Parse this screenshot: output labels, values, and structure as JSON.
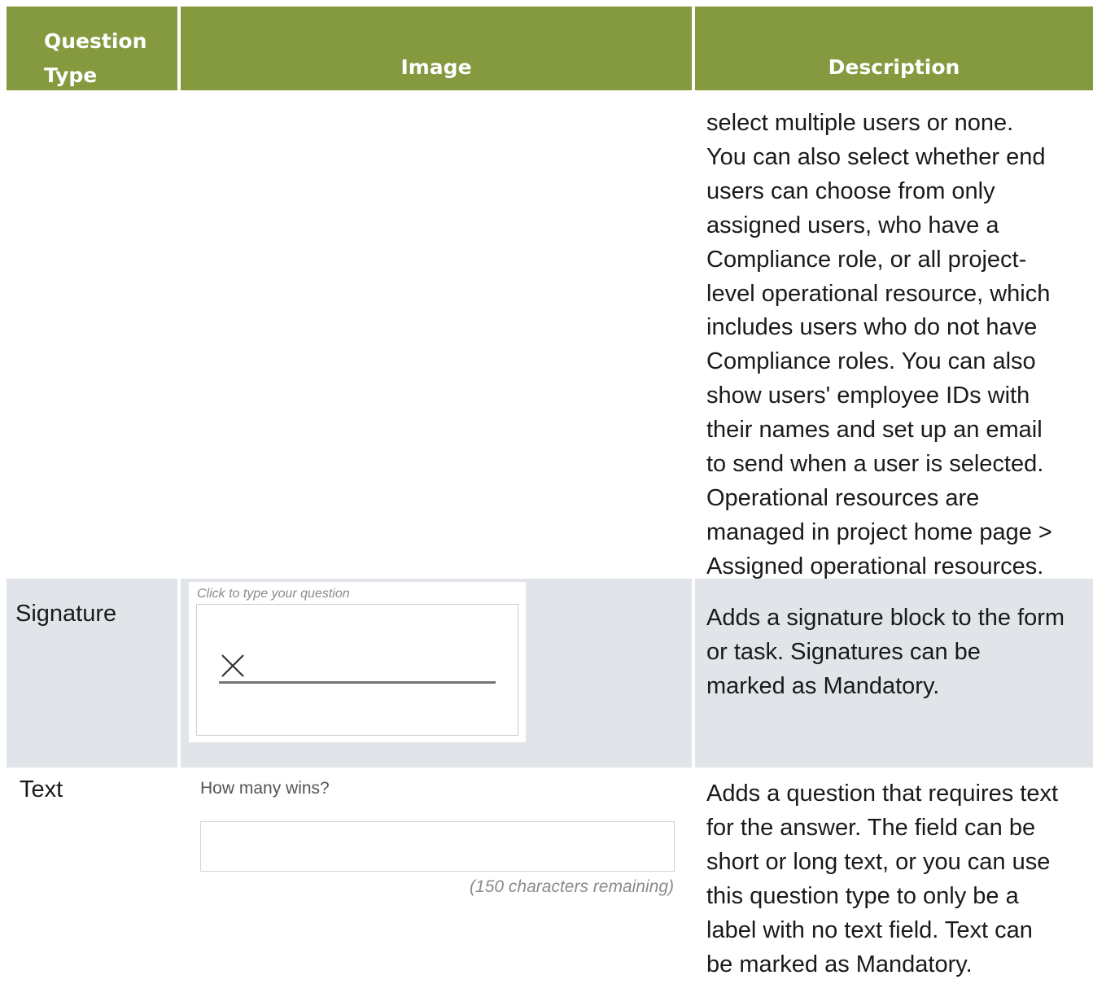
{
  "header": {
    "col1_line1": "Question",
    "col1_line2": "Type",
    "col2": "Image",
    "col3": "Description"
  },
  "continued_row": {
    "description_lines": [
      "select multiple users or none.",
      "You can also select whether end",
      "users can choose from only",
      "assigned users, who have a",
      "Compliance role, or all project-",
      "level operational resource, which",
      "includes users who do not have",
      "Compliance roles. You can also",
      "show users' employee IDs with",
      "their names and set up an email",
      "to send when a user is selected.",
      "Operational resources are",
      "managed in project home page >",
      "Assigned operational resources."
    ]
  },
  "signature_row": {
    "type": "Signature",
    "image": {
      "question_placeholder": "Click to type your question",
      "x_mark": "×"
    },
    "description_lines": [
      "Adds a signature block to the form",
      "or task. Signatures can be",
      "marked as Mandatory."
    ]
  },
  "text_row": {
    "type": "Text",
    "image": {
      "question": "How many wins?",
      "input_value": "",
      "remaining": "(150 characters remaining)"
    },
    "description_lines": [
      "Adds a question that requires text",
      "for the answer. The field can be",
      "short or long text, or you can use",
      "this question type to only be a",
      "label with no text field. Text can",
      "be marked as Mandatory."
    ]
  },
  "colors": {
    "header_bg": "#85993e",
    "header_text": "#ffffff",
    "shaded_row": "#e1e4e8"
  }
}
